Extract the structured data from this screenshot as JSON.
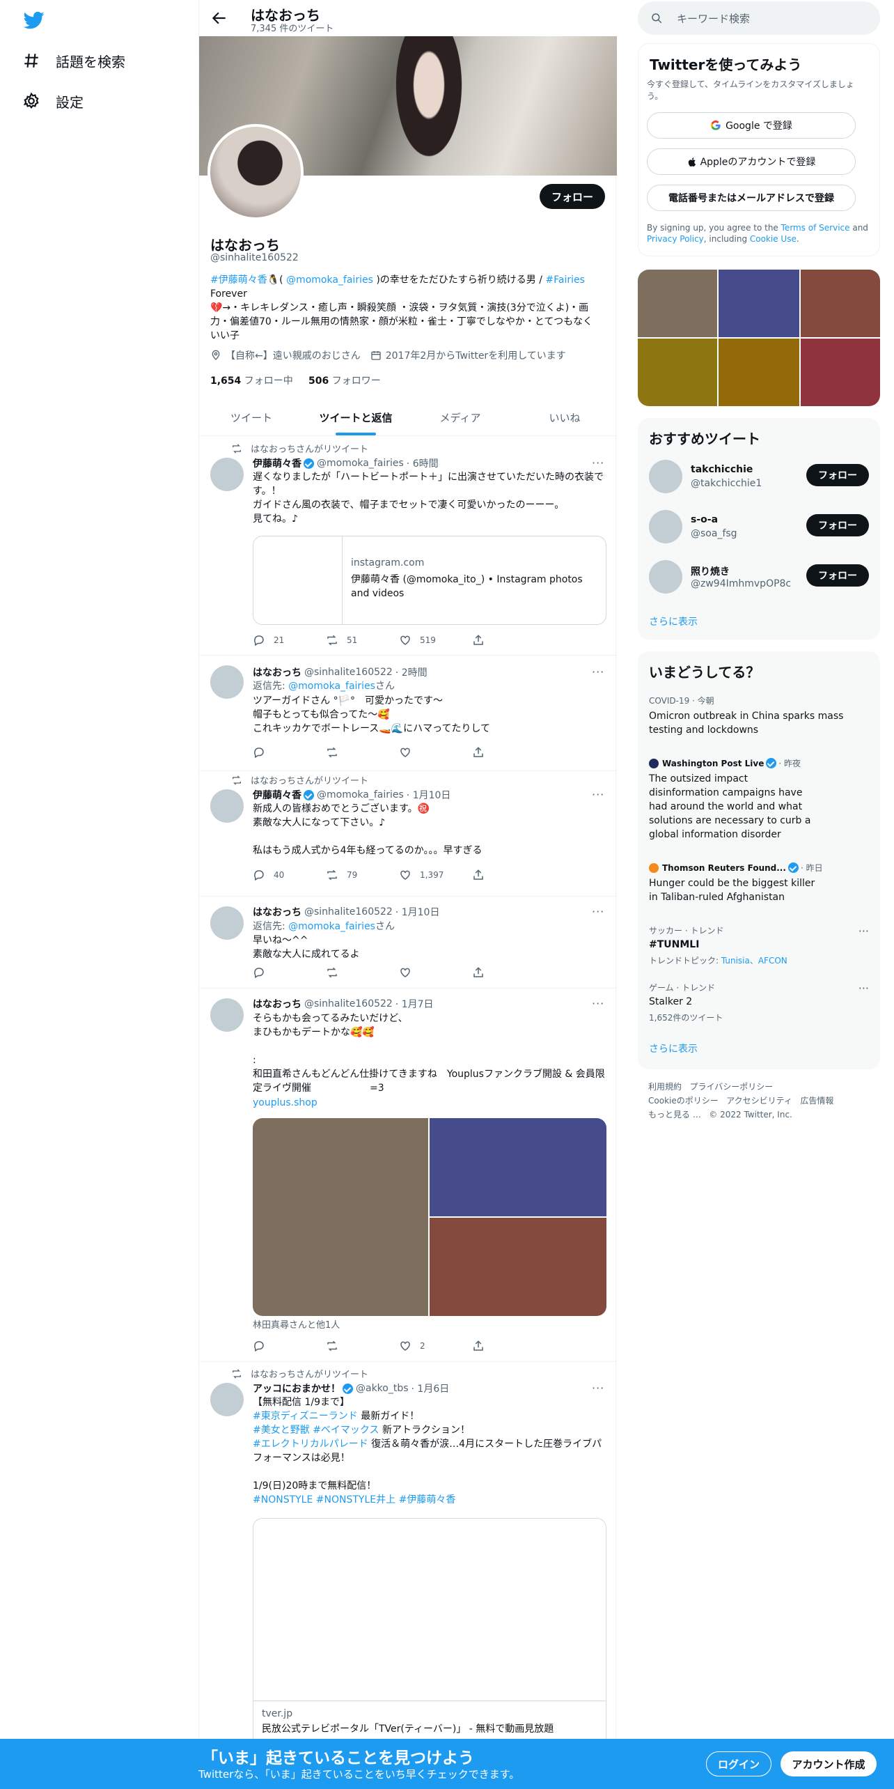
{
  "nav": {
    "explore": "話題を検索",
    "settings": "設定"
  },
  "header": {
    "name": "はなおっち",
    "tweet_count": "7,345 件のツイート"
  },
  "profile": {
    "follow": "フォロー",
    "name": "はなおっち",
    "handle": "@sinhalite160522",
    "bio_tag1": "#伊藤萌々香",
    "bio_mid1": "🐧( ",
    "bio_mention": "@momoka_fairies",
    "bio_mid2": " )の幸せをただひたすら祈り続ける男 / ",
    "bio_tag2": "#Fairies",
    "bio_line2": "Forever",
    "bio_line3": "💔→・キレキレダンス・癒し声・瞬殺笑顔 ・涙袋・ヲタ気質・演技(3分で泣くよ)・画力・偏差値70・ルール無用の情熱家・顔が米粒・雀士・丁寧でしなやか・とてつもなくいい子",
    "location": "【自称←】遠い親戚のおじさん",
    "joined": "2017年2月からTwitterを利用しています",
    "following_count": "1,654",
    "following_label": "フォロー中",
    "followers_count": "506",
    "followers_label": "フォロワー"
  },
  "tabs": [
    "ツイート",
    "ツイートと返信",
    "メディア",
    "いいね"
  ],
  "tweets": [
    {
      "rt_label": "はなおっちさんがリツイート",
      "name": "伊藤萌々香",
      "handle": "@momoka_fairies",
      "time": "· 6時間",
      "text": "遅くなりましたが「ハートビートポート＋」に出演させていただいた時の衣装です。！\nガイドさん風の衣装で、帽子までセットで凄く可愛いかったのーーー。\n見てね。♪",
      "card_domain": "instagram.com",
      "card_title": "伊藤萌々香 (@momoka_ito_) • Instagram photos and videos",
      "replies": "21",
      "retweets": "51",
      "likes": "519"
    },
    {
      "name": "はなおっち",
      "handle": "@sinhalite160522",
      "time": "· 2時間",
      "reply_to_label": "返信先: ",
      "reply_to": "@momoka_fairies",
      "reply_suffix": "さん",
      "text": "ツアーガイドさん °🏳️°　可愛かったです〜\n帽子もとっても似合ってた〜🥰\nこれキッカケでボートレース🚤🌊にハマってたりして"
    },
    {
      "rt_label": "はなおっちさんがリツイート",
      "name": "伊藤萌々香",
      "handle": "@momoka_fairies",
      "time": "· 1月10日",
      "text": "新成人の皆様おめでとうございます。㊗️\n素敵な大人になって下さい。♪\n\n私はもう成人式から4年も経ってるのか。。。早すぎる",
      "replies": "40",
      "retweets": "79",
      "likes": "1,397"
    },
    {
      "name": "はなおっち",
      "handle": "@sinhalite160522",
      "time": "· 1月10日",
      "reply_to_label": "返信先: ",
      "reply_to": "@momoka_fairies",
      "reply_suffix": "さん",
      "text": "早いね〜^^\n素敵な大人に成れてるよ"
    },
    {
      "name": "はなおっち",
      "handle": "@sinhalite160522",
      "time": "· 1月7日",
      "text": "そらもかも会ってるみたいだけど、\nまひもかもデートかな🥰🥰\n\n:\n和田直希さんもどんどん仕掛けてきますね　Youplusファンクラブ開設 & 会員限定ライヴ開催　　　　　　=3",
      "link": "youplus.shop",
      "tagged": "林田真尋さんと他1人",
      "likes": "2"
    },
    {
      "rt_label": "はなおっちさんがリツイート",
      "name": "アッコにおまかせ！",
      "handle": "@akko_tbs",
      "time": "· 1月6日",
      "line1": "【無料配信 1/9まで】",
      "tag1": "#東京ディズニーランド",
      "line2_rest": " 最新ガイド！",
      "tag2": "#美女と野獣",
      "tag3": "#ベイマックス",
      "line3_rest": " 新アトラクション！",
      "tag4": "#エレクトリカルパレード",
      "line4_rest": " 復活＆萌々香が涙…4月にスタートした圧巻ライブパフォーマンスは必見！",
      "line5": "1/9(日)20時まで無料配信！",
      "tag5": "#NONSTYLE",
      "tag6": "#NONSTYLE井上",
      "tag7": "#伊藤萌々香",
      "card_domain": "tver.jp",
      "card_title": "民放公式テレビポータル「TVer(ティーバー)」 - 無料で動画見放題"
    }
  ],
  "right": {
    "search_placeholder": "キーワード検索",
    "signup_title": "Twitterを使ってみよう",
    "signup_desc": "今すぐ登録して、タイムラインをカスタマイズしましょう。",
    "google_btn": "Google で登録",
    "apple_btn": "Appleのアカウントで登録",
    "phone_btn": "電話番号またはメールアドレスで登録",
    "terms_pre": "By signing up, you agree to the ",
    "terms_link": "Terms of Service",
    "terms_and": " and ",
    "privacy_link": "Privacy Policy",
    "terms_incl": ", including ",
    "cookie_link": "Cookie Use",
    "terms_end": ".",
    "recommend_title": "おすすめツイート",
    "suggestions": [
      {
        "name": "takchicchie",
        "handle": "@takchicchie1",
        "btn": "フォロー"
      },
      {
        "name": "s-o-a",
        "handle": "@soa_fsg",
        "btn": "フォロー"
      },
      {
        "name": "照り焼き",
        "handle": "@zw94ImhmvpOP8c",
        "btn": "フォロー"
      }
    ],
    "show_more": "さらに表示",
    "trends_title": "いまどうしてる？",
    "trends": [
      {
        "context": "COVID-19 · 今朝",
        "text": "Omicron outbreak in China sparks mass testing and lockdowns"
      },
      {
        "source": "Washington Post Live",
        "time": "· 昨夜",
        "text": "The outsized impact disinformation campaigns have had around the world and what solutions are necessary to curb a global information disorder"
      },
      {
        "source": "Thomson Reuters Found...",
        "time": "· 昨日",
        "text": "Hunger could be the biggest killer in Taliban-ruled Afghanistan"
      },
      {
        "context": "サッカー · トレンド",
        "text": "#TUNMLI",
        "sub_label": "トレンドトピック: ",
        "sub_links": "Tunisia、AFCON"
      },
      {
        "context": "ゲーム · トレンド",
        "text": "Stalker 2",
        "sub": "1,652件のツイート"
      }
    ],
    "trends_more": "さらに表示",
    "footer": [
      "利用規約",
      "プライバシーポリシー",
      "Cookieのポリシー",
      "アクセシビリティ",
      "広告情報",
      "もっと見る …",
      "© 2022 Twitter, Inc."
    ]
  },
  "bottom": {
    "title": "「いま」起きていることを見つけよう",
    "subtitle": "Twitterなら、「いま」起きていることをいち早くチェックできます。",
    "login": "ログイン",
    "signup": "アカウント作成"
  },
  "colors": {
    "accent": "#1d9bf0",
    "text": "#0f1419",
    "muted": "#536471",
    "media_tile_1": "#7d6e5e",
    "media_tile_2": "#464c8b",
    "media_tile_3": "#844a3d",
    "media_tile_4": "#8d7611",
    "media_tile_5": "#936a0a",
    "media_tile_6": "#8f333c"
  }
}
